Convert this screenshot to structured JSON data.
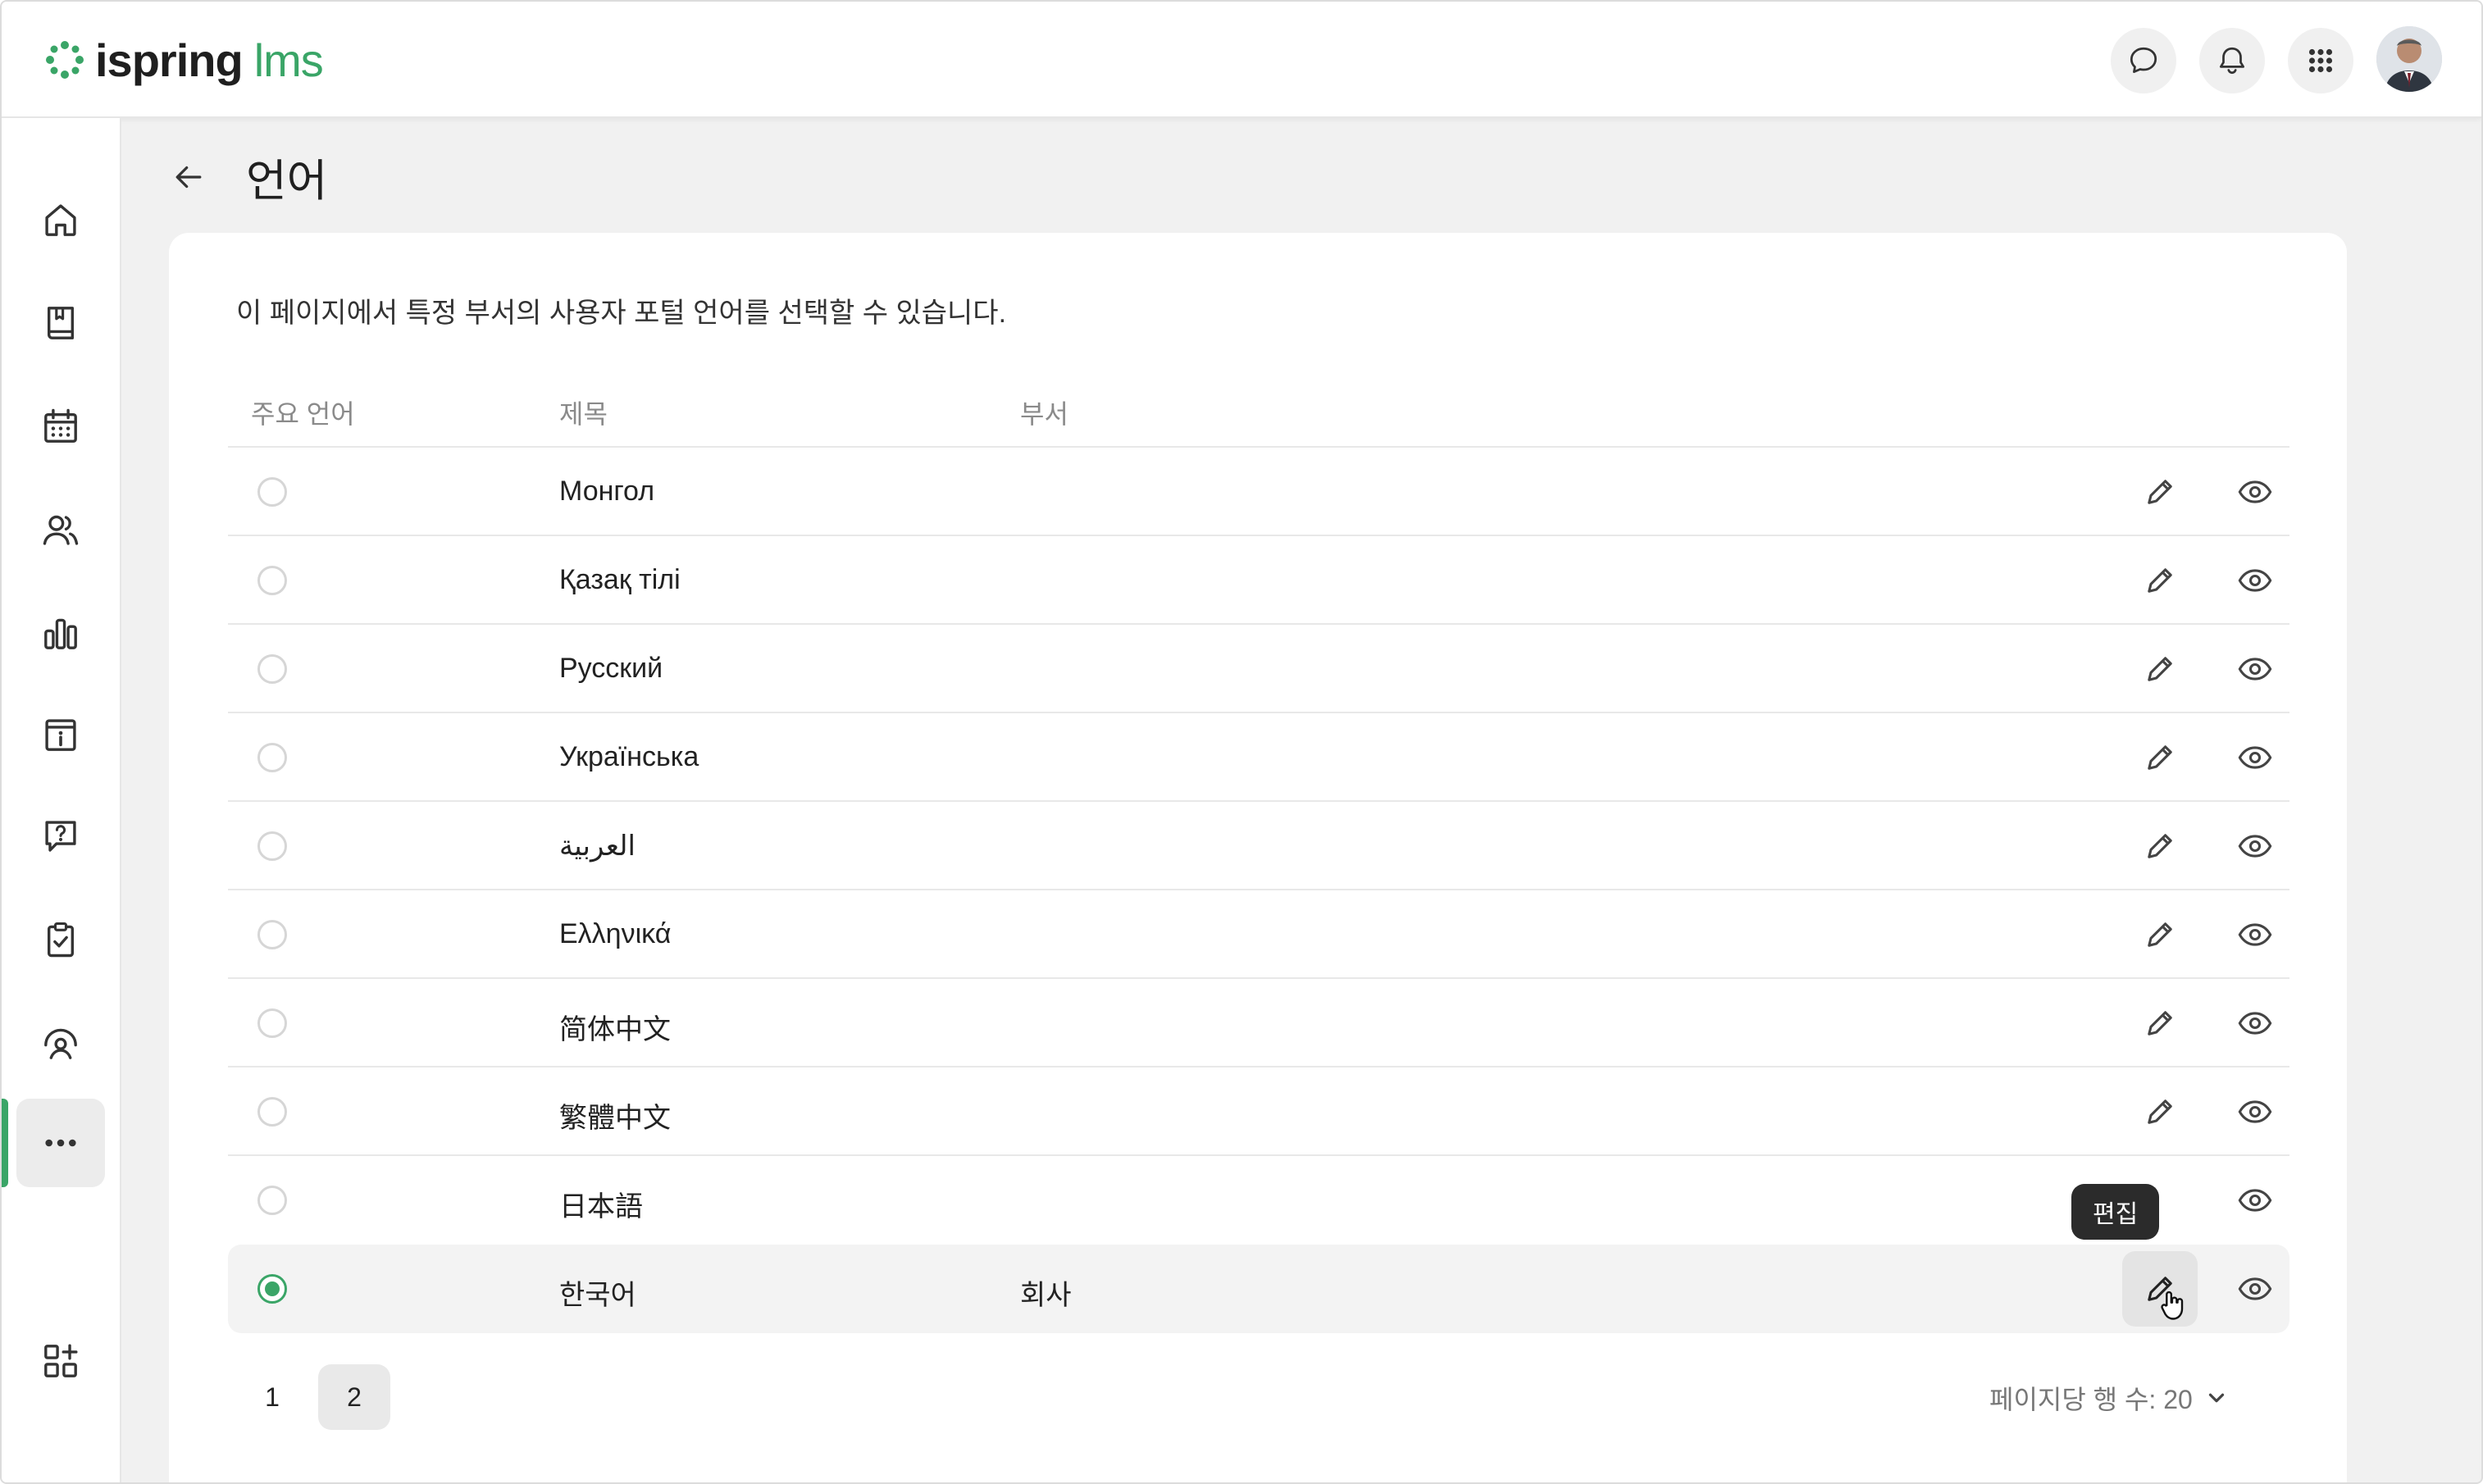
{
  "app": {
    "logo_word": "ispring",
    "logo_suffix": "lms",
    "accent_color": "#3aa567"
  },
  "header": {
    "buttons": [
      {
        "icon": "chat-bubble-icon"
      },
      {
        "icon": "bell-icon"
      },
      {
        "icon": "apps-grid-icon"
      }
    ],
    "avatar": "user-avatar"
  },
  "sidebar": {
    "items": [
      {
        "icon": "home-icon"
      },
      {
        "icon": "book-icon"
      },
      {
        "icon": "calendar-icon"
      },
      {
        "icon": "users-icon"
      },
      {
        "icon": "bar-chart-icon"
      },
      {
        "icon": "info-board-icon"
      },
      {
        "icon": "question-chat-icon"
      },
      {
        "icon": "clipboard-check-icon"
      },
      {
        "icon": "gauge-user-icon"
      },
      {
        "icon": "more-icon",
        "active": true
      }
    ],
    "bottom_item": {
      "icon": "add-widget-icon"
    }
  },
  "page": {
    "title": "언어",
    "description": "이 페이지에서 특정 부서의 사용자 포털 언어를 선택할 수 있습니다."
  },
  "table": {
    "headers": {
      "primary": "주요 언어",
      "title": "제목",
      "department": "부서"
    },
    "rows": [
      {
        "title": "Монгол",
        "department": "",
        "selected": false
      },
      {
        "title": "Қазақ тілі",
        "department": "",
        "selected": false
      },
      {
        "title": "Русский",
        "department": "",
        "selected": false
      },
      {
        "title": "Українська",
        "department": "",
        "selected": false
      },
      {
        "title": "العربية",
        "department": "",
        "selected": false
      },
      {
        "title": "Ελληνικά",
        "department": "",
        "selected": false
      },
      {
        "title": "简体中文",
        "department": "",
        "selected": false
      },
      {
        "title": "繁體中文",
        "department": "",
        "selected": false
      },
      {
        "title": "日本語",
        "department": "",
        "selected": false
      },
      {
        "title": "한국어",
        "department": "회사",
        "selected": true
      }
    ],
    "edit_tooltip": "편집"
  },
  "pagination": {
    "pages": [
      "1",
      "2"
    ],
    "current": "2",
    "rows_per_page_label": "페이지당 행 수: 20"
  }
}
